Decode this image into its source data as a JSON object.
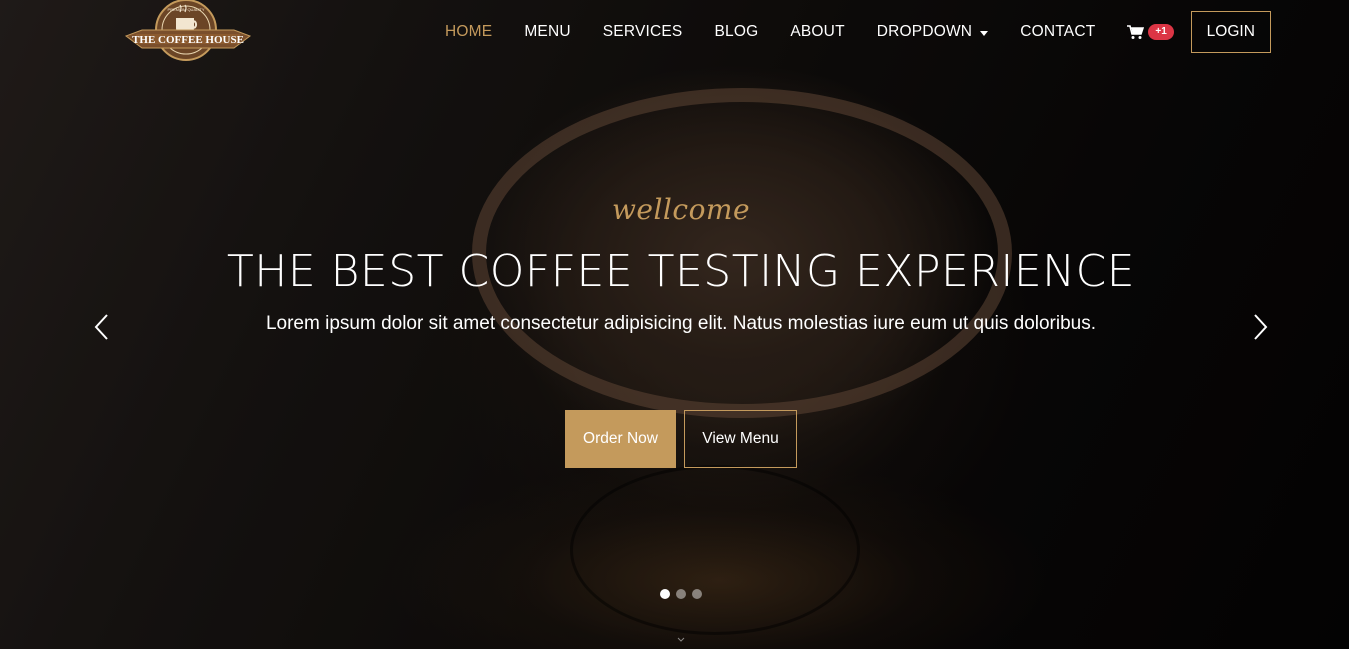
{
  "brand": {
    "logo_text": "THE COFFEE HOUSE",
    "logo_tagline": "PREMIUM QUALITY"
  },
  "nav": {
    "items": [
      {
        "label": "HOME",
        "active": true
      },
      {
        "label": "MENU",
        "active": false
      },
      {
        "label": "SERVICES",
        "active": false
      },
      {
        "label": "BLOG",
        "active": false
      },
      {
        "label": "ABOUT",
        "active": false
      },
      {
        "label": "DROPDOWN",
        "active": false,
        "has_caret": true
      },
      {
        "label": "CONTACT",
        "active": false
      }
    ],
    "cart_icon": "shopping-cart-icon",
    "cart_badge": "+1",
    "login_label": "LOGIN"
  },
  "hero": {
    "kicker": "wellcome",
    "headline": "THE BEST COFFEE TESTING EXPERIENCE",
    "subtext": "Lorem ipsum dolor sit amet consectetur adipisicing elit. Natus molestias iure eum ut quis doloribus.",
    "primary_button": "Order Now",
    "secondary_button": "View Menu"
  },
  "carousel": {
    "prev_icon": "chevron-left-icon",
    "next_icon": "chevron-right-icon",
    "slides": 3,
    "active_slide": 1,
    "scroll_icon": "chevron-down-icon"
  },
  "colors": {
    "accent": "#c49a5c",
    "badge": "#dc3545",
    "text": "#ffffff",
    "background": "#0b0908"
  }
}
